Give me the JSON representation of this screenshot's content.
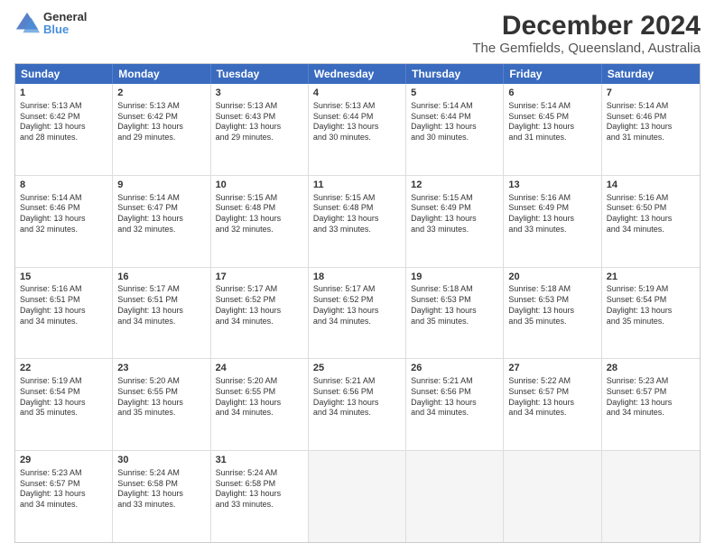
{
  "header": {
    "logo_line1": "General",
    "logo_line2": "Blue",
    "main_title": "December 2024",
    "sub_title": "The Gemfields, Queensland, Australia"
  },
  "calendar": {
    "days": [
      "Sunday",
      "Monday",
      "Tuesday",
      "Wednesday",
      "Thursday",
      "Friday",
      "Saturday"
    ],
    "weeks": [
      [
        {
          "num": "",
          "lines": []
        },
        {
          "num": "2",
          "lines": [
            "Sunrise: 5:13 AM",
            "Sunset: 6:42 PM",
            "Daylight: 13 hours",
            "and 29 minutes."
          ]
        },
        {
          "num": "3",
          "lines": [
            "Sunrise: 5:13 AM",
            "Sunset: 6:43 PM",
            "Daylight: 13 hours",
            "and 29 minutes."
          ]
        },
        {
          "num": "4",
          "lines": [
            "Sunrise: 5:13 AM",
            "Sunset: 6:44 PM",
            "Daylight: 13 hours",
            "and 30 minutes."
          ]
        },
        {
          "num": "5",
          "lines": [
            "Sunrise: 5:14 AM",
            "Sunset: 6:44 PM",
            "Daylight: 13 hours",
            "and 30 minutes."
          ]
        },
        {
          "num": "6",
          "lines": [
            "Sunrise: 5:14 AM",
            "Sunset: 6:45 PM",
            "Daylight: 13 hours",
            "and 31 minutes."
          ]
        },
        {
          "num": "7",
          "lines": [
            "Sunrise: 5:14 AM",
            "Sunset: 6:46 PM",
            "Daylight: 13 hours",
            "and 31 minutes."
          ]
        }
      ],
      [
        {
          "num": "1",
          "lines": [
            "Sunrise: 5:13 AM",
            "Sunset: 6:42 PM",
            "Daylight: 13 hours",
            "and 28 minutes."
          ]
        },
        {
          "num": "9",
          "lines": [
            "Sunrise: 5:14 AM",
            "Sunset: 6:47 PM",
            "Daylight: 13 hours",
            "and 32 minutes."
          ]
        },
        {
          "num": "10",
          "lines": [
            "Sunrise: 5:15 AM",
            "Sunset: 6:48 PM",
            "Daylight: 13 hours",
            "and 32 minutes."
          ]
        },
        {
          "num": "11",
          "lines": [
            "Sunrise: 5:15 AM",
            "Sunset: 6:48 PM",
            "Daylight: 13 hours",
            "and 33 minutes."
          ]
        },
        {
          "num": "12",
          "lines": [
            "Sunrise: 5:15 AM",
            "Sunset: 6:49 PM",
            "Daylight: 13 hours",
            "and 33 minutes."
          ]
        },
        {
          "num": "13",
          "lines": [
            "Sunrise: 5:16 AM",
            "Sunset: 6:49 PM",
            "Daylight: 13 hours",
            "and 33 minutes."
          ]
        },
        {
          "num": "14",
          "lines": [
            "Sunrise: 5:16 AM",
            "Sunset: 6:50 PM",
            "Daylight: 13 hours",
            "and 34 minutes."
          ]
        }
      ],
      [
        {
          "num": "8",
          "lines": [
            "Sunrise: 5:14 AM",
            "Sunset: 6:46 PM",
            "Daylight: 13 hours",
            "and 32 minutes."
          ]
        },
        {
          "num": "16",
          "lines": [
            "Sunrise: 5:17 AM",
            "Sunset: 6:51 PM",
            "Daylight: 13 hours",
            "and 34 minutes."
          ]
        },
        {
          "num": "17",
          "lines": [
            "Sunrise: 5:17 AM",
            "Sunset: 6:52 PM",
            "Daylight: 13 hours",
            "and 34 minutes."
          ]
        },
        {
          "num": "18",
          "lines": [
            "Sunrise: 5:17 AM",
            "Sunset: 6:52 PM",
            "Daylight: 13 hours",
            "and 34 minutes."
          ]
        },
        {
          "num": "19",
          "lines": [
            "Sunrise: 5:18 AM",
            "Sunset: 6:53 PM",
            "Daylight: 13 hours",
            "and 35 minutes."
          ]
        },
        {
          "num": "20",
          "lines": [
            "Sunrise: 5:18 AM",
            "Sunset: 6:53 PM",
            "Daylight: 13 hours",
            "and 35 minutes."
          ]
        },
        {
          "num": "21",
          "lines": [
            "Sunrise: 5:19 AM",
            "Sunset: 6:54 PM",
            "Daylight: 13 hours",
            "and 35 minutes."
          ]
        }
      ],
      [
        {
          "num": "15",
          "lines": [
            "Sunrise: 5:16 AM",
            "Sunset: 6:51 PM",
            "Daylight: 13 hours",
            "and 34 minutes."
          ]
        },
        {
          "num": "23",
          "lines": [
            "Sunrise: 5:20 AM",
            "Sunset: 6:55 PM",
            "Daylight: 13 hours",
            "and 35 minutes."
          ]
        },
        {
          "num": "24",
          "lines": [
            "Sunrise: 5:20 AM",
            "Sunset: 6:55 PM",
            "Daylight: 13 hours",
            "and 34 minutes."
          ]
        },
        {
          "num": "25",
          "lines": [
            "Sunrise: 5:21 AM",
            "Sunset: 6:56 PM",
            "Daylight: 13 hours",
            "and 34 minutes."
          ]
        },
        {
          "num": "26",
          "lines": [
            "Sunrise: 5:21 AM",
            "Sunset: 6:56 PM",
            "Daylight: 13 hours",
            "and 34 minutes."
          ]
        },
        {
          "num": "27",
          "lines": [
            "Sunrise: 5:22 AM",
            "Sunset: 6:57 PM",
            "Daylight: 13 hours",
            "and 34 minutes."
          ]
        },
        {
          "num": "28",
          "lines": [
            "Sunrise: 5:23 AM",
            "Sunset: 6:57 PM",
            "Daylight: 13 hours",
            "and 34 minutes."
          ]
        }
      ],
      [
        {
          "num": "22",
          "lines": [
            "Sunrise: 5:19 AM",
            "Sunset: 6:54 PM",
            "Daylight: 13 hours",
            "and 35 minutes."
          ]
        },
        {
          "num": "30",
          "lines": [
            "Sunrise: 5:24 AM",
            "Sunset: 6:58 PM",
            "Daylight: 13 hours",
            "and 33 minutes."
          ]
        },
        {
          "num": "31",
          "lines": [
            "Sunrise: 5:24 AM",
            "Sunset: 6:58 PM",
            "Daylight: 13 hours",
            "and 33 minutes."
          ]
        },
        {
          "num": "",
          "lines": []
        },
        {
          "num": "",
          "lines": []
        },
        {
          "num": "",
          "lines": []
        },
        {
          "num": "",
          "lines": []
        }
      ],
      [
        {
          "num": "29",
          "lines": [
            "Sunrise: 5:23 AM",
            "Sunset: 6:57 PM",
            "Daylight: 13 hours",
            "and 34 minutes."
          ]
        },
        {
          "num": "",
          "lines": []
        },
        {
          "num": "",
          "lines": []
        },
        {
          "num": "",
          "lines": []
        },
        {
          "num": "",
          "lines": []
        },
        {
          "num": "",
          "lines": []
        },
        {
          "num": "",
          "lines": []
        }
      ]
    ]
  }
}
